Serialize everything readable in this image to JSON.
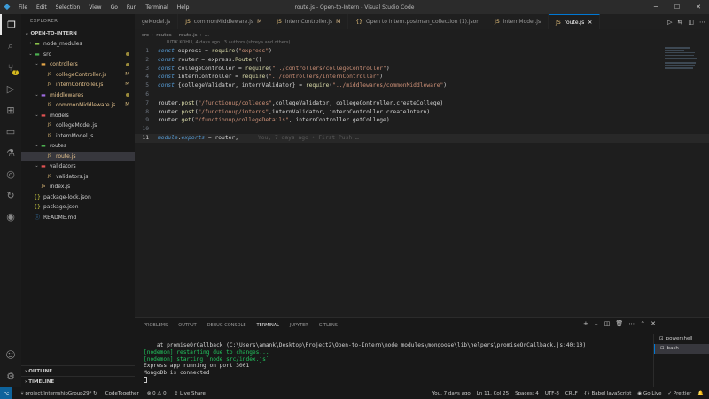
{
  "window": {
    "title": "route.js - Open-to-Intern - Visual Studio Code",
    "menu": [
      "File",
      "Edit",
      "Selection",
      "View",
      "Go",
      "Run",
      "Terminal",
      "Help"
    ]
  },
  "activity": {
    "scm_badge": "7"
  },
  "explorer": {
    "header": "EXPLORER",
    "root": "OPEN-TO-INTERN",
    "outline": "OUTLINE",
    "timeline": "TIMELINE",
    "tree": [
      {
        "name": "node_modules",
        "depth": 1,
        "type": "folder",
        "open": false
      },
      {
        "name": "src",
        "depth": 1,
        "type": "folder",
        "open": true,
        "dot": true
      },
      {
        "name": "controllers",
        "depth": 2,
        "type": "folder",
        "open": true,
        "dot": true,
        "mod": true
      },
      {
        "name": "collegeController.js",
        "depth": 3,
        "type": "js",
        "status": "M",
        "mod": true
      },
      {
        "name": "internController.js",
        "depth": 3,
        "type": "js",
        "status": "M",
        "mod": true
      },
      {
        "name": "middlewares",
        "depth": 2,
        "type": "folder",
        "open": true,
        "dot": true,
        "mod": true
      },
      {
        "name": "commonMiddleware.js",
        "depth": 3,
        "type": "js",
        "status": "M",
        "mod": true
      },
      {
        "name": "models",
        "depth": 2,
        "type": "folder",
        "open": true
      },
      {
        "name": "collegeModel.js",
        "depth": 3,
        "type": "js"
      },
      {
        "name": "internModel.js",
        "depth": 3,
        "type": "js"
      },
      {
        "name": "routes",
        "depth": 2,
        "type": "folder",
        "open": true
      },
      {
        "name": "route.js",
        "depth": 3,
        "type": "js",
        "selected": true,
        "mod": true
      },
      {
        "name": "validators",
        "depth": 2,
        "type": "folder",
        "open": true
      },
      {
        "name": "validators.js",
        "depth": 3,
        "type": "js"
      },
      {
        "name": "index.js",
        "depth": 2,
        "type": "js"
      },
      {
        "name": "package-lock.json",
        "depth": 1,
        "type": "json"
      },
      {
        "name": "package.json",
        "depth": 1,
        "type": "json"
      },
      {
        "name": "README.md",
        "depth": 1,
        "type": "md"
      }
    ]
  },
  "tabs": [
    {
      "label": "geModel.js",
      "mod": ""
    },
    {
      "label": "commonMiddleware.js",
      "mod": "M"
    },
    {
      "label": "internController.js",
      "mod": "M"
    },
    {
      "label": "Open to intern.postman_collection (1).json",
      "mod": ""
    },
    {
      "label": "internModel.js",
      "mod": ""
    },
    {
      "label": "route.js",
      "mod": "",
      "active": true
    }
  ],
  "breadcrumb": [
    "src",
    "routes",
    "route.js",
    "..."
  ],
  "blame_header": "RITIK KOHLI, 4 days ago | 3 authors (shreya and others)",
  "code_lines": [
    {
      "n": "1",
      "segs": [
        [
          "kw",
          "const"
        ],
        [
          "code",
          " express = "
        ],
        [
          "fn",
          "require"
        ],
        [
          "code",
          "("
        ],
        [
          "str",
          "\"express\""
        ],
        [
          "code",
          ")"
        ]
      ]
    },
    {
      "n": "2",
      "segs": [
        [
          "kw",
          "const"
        ],
        [
          "code",
          " router = express."
        ],
        [
          "fn",
          "Router"
        ],
        [
          "code",
          "()"
        ]
      ]
    },
    {
      "n": "3",
      "segs": [
        [
          "kw",
          "const"
        ],
        [
          "code",
          " collegeController = "
        ],
        [
          "fn",
          "require"
        ],
        [
          "code",
          "("
        ],
        [
          "str",
          "\"../controllers/collegeController\""
        ],
        [
          "code",
          ")"
        ]
      ]
    },
    {
      "n": "4",
      "segs": [
        [
          "kw",
          "const"
        ],
        [
          "code",
          " internController = "
        ],
        [
          "fn",
          "require"
        ],
        [
          "code",
          "("
        ],
        [
          "str",
          "\"../controllers/internController\""
        ],
        [
          "code",
          ")"
        ]
      ]
    },
    {
      "n": "5",
      "segs": [
        [
          "kw",
          "const"
        ],
        [
          "code",
          " {collegeValidator, internValidator} = "
        ],
        [
          "fn",
          "require"
        ],
        [
          "code",
          "("
        ],
        [
          "str",
          "\"../middlewares/commonMiddleware\""
        ],
        [
          "code",
          ")"
        ]
      ]
    },
    {
      "n": "6",
      "segs": []
    },
    {
      "n": "7",
      "segs": [
        [
          "code",
          "router."
        ],
        [
          "fn",
          "post"
        ],
        [
          "code",
          "("
        ],
        [
          "str",
          "\"/functionup/colleges\""
        ],
        [
          "code",
          ",collegeValidator, collegeController.createCollege)"
        ]
      ]
    },
    {
      "n": "8",
      "segs": [
        [
          "code",
          "router."
        ],
        [
          "fn",
          "post"
        ],
        [
          "code",
          "("
        ],
        [
          "str",
          "\"/functionup/interns\""
        ],
        [
          "code",
          ",internValidator, internController.createIntern)"
        ]
      ]
    },
    {
      "n": "9",
      "segs": [
        [
          "code",
          "router."
        ],
        [
          "fn",
          "get"
        ],
        [
          "code",
          "("
        ],
        [
          "str",
          "\"/functionup/collegeDetails\""
        ],
        [
          "code",
          ", internController.getCollege)"
        ]
      ]
    },
    {
      "n": "10",
      "segs": []
    },
    {
      "n": "11",
      "segs": [
        [
          "kw",
          "module"
        ],
        [
          "code",
          "."
        ],
        [
          "kw",
          "exports"
        ],
        [
          "code",
          " = router;"
        ]
      ],
      "current": true,
      "blame": "You, 7 days ago • First Push …"
    }
  ],
  "panel": {
    "tabs": [
      "PROBLEMS",
      "OUTPUT",
      "DEBUG CONSOLE",
      "TERMINAL",
      "JUPYTER",
      "GITLENS"
    ],
    "active_tab": "TERMINAL",
    "terminal_lines": [
      {
        "text": "    at promiseOrCallback (C:\\Users\\amank\\Desktop\\Project2\\Open-to-Intern\\node_modules\\mongoose\\lib\\helpers\\promiseOrCallback.js:40:10)",
        "cls": ""
      },
      {
        "text": "[nodemon] restarting due to changes...",
        "cls": "green"
      },
      {
        "text": "[nodemon] starting `node src/index.js`",
        "cls": "green"
      },
      {
        "text": "Express app running on port 3001",
        "cls": ""
      },
      {
        "text": "MongoDb is connected",
        "cls": ""
      }
    ],
    "terminals": [
      {
        "label": "powershell",
        "active": false
      },
      {
        "label": "bash",
        "active": true
      }
    ]
  },
  "status": {
    "branch": "project/internshipGroup29*",
    "codetogether": "CodeTogether",
    "problems": "⊗ 0 ⚠ 0",
    "liveshare": "Live Share",
    "blame": "You, 7 days ago",
    "position": "Ln 11, Col 25",
    "spaces": "Spaces: 4",
    "encoding": "UTF-8",
    "eol": "CRLF",
    "language": "{} Babel JavaScript",
    "golive": "Go Live",
    "prettier": "✓ Prettier"
  }
}
